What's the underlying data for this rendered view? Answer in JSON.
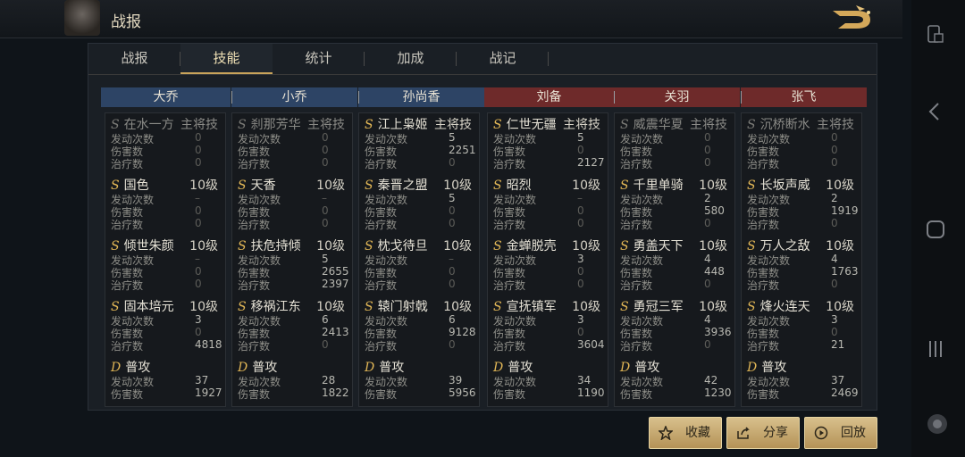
{
  "header": {
    "title": "战报"
  },
  "tabs": [
    {
      "label": "战报",
      "active": false
    },
    {
      "label": "技能",
      "active": true
    },
    {
      "label": "统计",
      "active": false
    },
    {
      "label": "加成",
      "active": false
    },
    {
      "label": "战记",
      "active": false
    }
  ],
  "heroes": [
    {
      "name": "大乔",
      "side": "blue",
      "skills": [
        {
          "grade": "S",
          "name": "在水一方",
          "tag": "主将技",
          "gray": true,
          "stats": [
            {
              "label": "发动次数",
              "value": "0"
            },
            {
              "label": "伤害数",
              "value": "0"
            },
            {
              "label": "治疗数",
              "value": "0"
            }
          ]
        },
        {
          "grade": "S",
          "name": "国色",
          "tag": "10级",
          "gray": false,
          "stats": [
            {
              "label": "发动次数",
              "value": "–"
            },
            {
              "label": "伤害数",
              "value": "0"
            },
            {
              "label": "治疗数",
              "value": "0"
            }
          ]
        },
        {
          "grade": "S",
          "name": "倾世朱颜",
          "tag": "10级",
          "gray": false,
          "stats": [
            {
              "label": "发动次数",
              "value": "–"
            },
            {
              "label": "伤害数",
              "value": "0"
            },
            {
              "label": "治疗数",
              "value": "0"
            }
          ]
        },
        {
          "grade": "S",
          "name": "固本培元",
          "tag": "10级",
          "gray": false,
          "stats": [
            {
              "label": "发动次数",
              "value": "3"
            },
            {
              "label": "伤害数",
              "value": "0"
            },
            {
              "label": "治疗数",
              "value": "4818"
            }
          ]
        },
        {
          "grade": "D",
          "name": "普攻",
          "tag": "",
          "gray": false,
          "stats": [
            {
              "label": "发动次数",
              "value": "37"
            },
            {
              "label": "伤害数",
              "value": "1927"
            }
          ]
        }
      ]
    },
    {
      "name": "小乔",
      "side": "blue",
      "skills": [
        {
          "grade": "S",
          "name": "刹那芳华",
          "tag": "主将技",
          "gray": true,
          "stats": [
            {
              "label": "发动次数",
              "value": "0"
            },
            {
              "label": "伤害数",
              "value": "0"
            },
            {
              "label": "治疗数",
              "value": "0"
            }
          ]
        },
        {
          "grade": "S",
          "name": "天香",
          "tag": "10级",
          "gray": false,
          "stats": [
            {
              "label": "发动次数",
              "value": "–"
            },
            {
              "label": "伤害数",
              "value": "0"
            },
            {
              "label": "治疗数",
              "value": "0"
            }
          ]
        },
        {
          "grade": "S",
          "name": "扶危持倾",
          "tag": "10级",
          "gray": false,
          "stats": [
            {
              "label": "发动次数",
              "value": "5"
            },
            {
              "label": "伤害数",
              "value": "2655"
            },
            {
              "label": "治疗数",
              "value": "2397"
            }
          ]
        },
        {
          "grade": "S",
          "name": "移祸江东",
          "tag": "10级",
          "gray": false,
          "stats": [
            {
              "label": "发动次数",
              "value": "6"
            },
            {
              "label": "伤害数",
              "value": "2413"
            },
            {
              "label": "治疗数",
              "value": "0"
            }
          ]
        },
        {
          "grade": "D",
          "name": "普攻",
          "tag": "",
          "gray": false,
          "stats": [
            {
              "label": "发动次数",
              "value": "28"
            },
            {
              "label": "伤害数",
              "value": "1822"
            }
          ]
        }
      ]
    },
    {
      "name": "孙尚香",
      "side": "blue",
      "skills": [
        {
          "grade": "S",
          "name": "江上枭姬",
          "tag": "主将技",
          "gray": false,
          "stats": [
            {
              "label": "发动次数",
              "value": "5"
            },
            {
              "label": "伤害数",
              "value": "2251"
            },
            {
              "label": "治疗数",
              "value": "0"
            }
          ]
        },
        {
          "grade": "S",
          "name": "秦晋之盟",
          "tag": "10级",
          "gray": false,
          "stats": [
            {
              "label": "发动次数",
              "value": "5"
            },
            {
              "label": "伤害数",
              "value": "0"
            },
            {
              "label": "治疗数",
              "value": "0"
            }
          ]
        },
        {
          "grade": "S",
          "name": "枕戈待旦",
          "tag": "10级",
          "gray": false,
          "stats": [
            {
              "label": "发动次数",
              "value": "–"
            },
            {
              "label": "伤害数",
              "value": "0"
            },
            {
              "label": "治疗数",
              "value": "0"
            }
          ]
        },
        {
          "grade": "S",
          "name": "辕门射戟",
          "tag": "10级",
          "gray": false,
          "stats": [
            {
              "label": "发动次数",
              "value": "6"
            },
            {
              "label": "伤害数",
              "value": "9128"
            },
            {
              "label": "治疗数",
              "value": "0"
            }
          ]
        },
        {
          "grade": "D",
          "name": "普攻",
          "tag": "",
          "gray": false,
          "stats": [
            {
              "label": "发动次数",
              "value": "39"
            },
            {
              "label": "伤害数",
              "value": "5956"
            }
          ]
        }
      ]
    },
    {
      "name": "刘备",
      "side": "red",
      "skills": [
        {
          "grade": "S",
          "name": "仁世无疆",
          "tag": "主将技",
          "gray": false,
          "stats": [
            {
              "label": "发动次数",
              "value": "5"
            },
            {
              "label": "伤害数",
              "value": "0"
            },
            {
              "label": "治疗数",
              "value": "2127"
            }
          ]
        },
        {
          "grade": "S",
          "name": "昭烈",
          "tag": "10级",
          "gray": false,
          "stats": [
            {
              "label": "发动次数",
              "value": "–"
            },
            {
              "label": "伤害数",
              "value": "0"
            },
            {
              "label": "治疗数",
              "value": "0"
            }
          ]
        },
        {
          "grade": "S",
          "name": "金蝉脱壳",
          "tag": "10级",
          "gray": false,
          "stats": [
            {
              "label": "发动次数",
              "value": "3"
            },
            {
              "label": "伤害数",
              "value": "0"
            },
            {
              "label": "治疗数",
              "value": "0"
            }
          ]
        },
        {
          "grade": "S",
          "name": "宣抚镇军",
          "tag": "10级",
          "gray": false,
          "stats": [
            {
              "label": "发动次数",
              "value": "3"
            },
            {
              "label": "伤害数",
              "value": "0"
            },
            {
              "label": "治疗数",
              "value": "3604"
            }
          ]
        },
        {
          "grade": "D",
          "name": "普攻",
          "tag": "",
          "gray": false,
          "stats": [
            {
              "label": "发动次数",
              "value": "34"
            },
            {
              "label": "伤害数",
              "value": "1190"
            }
          ]
        }
      ]
    },
    {
      "name": "关羽",
      "side": "red",
      "skills": [
        {
          "grade": "S",
          "name": "威震华夏",
          "tag": "主将技",
          "gray": true,
          "stats": [
            {
              "label": "发动次数",
              "value": "0"
            },
            {
              "label": "伤害数",
              "value": "0"
            },
            {
              "label": "治疗数",
              "value": "0"
            }
          ]
        },
        {
          "grade": "S",
          "name": "千里单骑",
          "tag": "10级",
          "gray": false,
          "stats": [
            {
              "label": "发动次数",
              "value": "2"
            },
            {
              "label": "伤害数",
              "value": "580"
            },
            {
              "label": "治疗数",
              "value": "0"
            }
          ]
        },
        {
          "grade": "S",
          "name": "勇盖天下",
          "tag": "10级",
          "gray": false,
          "stats": [
            {
              "label": "发动次数",
              "value": "4"
            },
            {
              "label": "伤害数",
              "value": "448"
            },
            {
              "label": "治疗数",
              "value": "0"
            }
          ]
        },
        {
          "grade": "S",
          "name": "勇冠三军",
          "tag": "10级",
          "gray": false,
          "stats": [
            {
              "label": "发动次数",
              "value": "4"
            },
            {
              "label": "伤害数",
              "value": "3936"
            },
            {
              "label": "治疗数",
              "value": "0"
            }
          ]
        },
        {
          "grade": "D",
          "name": "普攻",
          "tag": "",
          "gray": false,
          "stats": [
            {
              "label": "发动次数",
              "value": "42"
            },
            {
              "label": "伤害数",
              "value": "1230"
            }
          ]
        }
      ]
    },
    {
      "name": "张飞",
      "side": "red",
      "skills": [
        {
          "grade": "S",
          "name": "沉桥断水",
          "tag": "主将技",
          "gray": true,
          "stats": [
            {
              "label": "发动次数",
              "value": "0"
            },
            {
              "label": "伤害数",
              "value": "0"
            },
            {
              "label": "治疗数",
              "value": "0"
            }
          ]
        },
        {
          "grade": "S",
          "name": "长坂声威",
          "tag": "10级",
          "gray": false,
          "stats": [
            {
              "label": "发动次数",
              "value": "2"
            },
            {
              "label": "伤害数",
              "value": "1919"
            },
            {
              "label": "治疗数",
              "value": "0"
            }
          ]
        },
        {
          "grade": "S",
          "name": "万人之敌",
          "tag": "10级",
          "gray": false,
          "stats": [
            {
              "label": "发动次数",
              "value": "4"
            },
            {
              "label": "伤害数",
              "value": "1763"
            },
            {
              "label": "治疗数",
              "value": "0"
            }
          ]
        },
        {
          "grade": "S",
          "name": "烽火连天",
          "tag": "10级",
          "gray": false,
          "stats": [
            {
              "label": "发动次数",
              "value": "3"
            },
            {
              "label": "伤害数",
              "value": "0"
            },
            {
              "label": "治疗数",
              "value": "21"
            }
          ]
        },
        {
          "grade": "D",
          "name": "普攻",
          "tag": "",
          "gray": false,
          "stats": [
            {
              "label": "发动次数",
              "value": "37"
            },
            {
              "label": "伤害数",
              "value": "2469"
            }
          ]
        }
      ]
    }
  ],
  "actions": {
    "favorite": {
      "label": "收藏",
      "icon": "star-icon"
    },
    "share": {
      "label": "分享",
      "icon": "share-icon"
    },
    "replay": {
      "label": "回放",
      "icon": "play-icon"
    }
  },
  "colors": {
    "blue_team": "#2d4465",
    "red_team": "#6e2a2a",
    "grade_s": "#e2b756",
    "button_gold": "#c9a96b"
  }
}
